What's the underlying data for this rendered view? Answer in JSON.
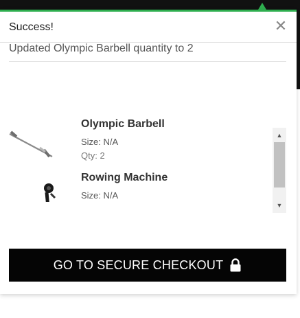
{
  "popup": {
    "title": "Success!",
    "close_icon": "close-icon",
    "message": "Updated Olympic Barbell quantity to 2"
  },
  "cart": {
    "items": [
      {
        "name": "Olympic Barbell",
        "size": "Size: N/A",
        "qty": "Qty: 2",
        "thumbnail": "barbell-image"
      },
      {
        "name": "Rowing Machine",
        "size": "Size: N/A",
        "thumbnail": "rowing-machine-image"
      }
    ]
  },
  "checkout": {
    "label": "GO TO SECURE CHECKOUT",
    "icon": "lock-icon"
  },
  "colors": {
    "accent": "#2eae4f",
    "button_bg": "#050505",
    "button_text": "#ffffff"
  }
}
